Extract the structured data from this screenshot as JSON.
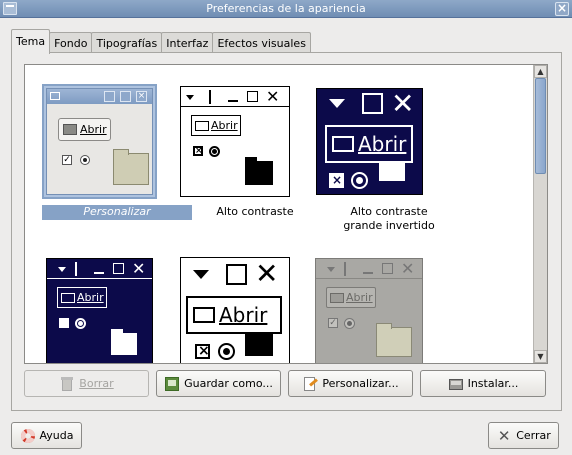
{
  "window": {
    "title": "Preferencias de la apariencia"
  },
  "tabs": [
    {
      "label": "Tema",
      "active": true
    },
    {
      "label": "Fondo"
    },
    {
      "label": "Tipografías"
    },
    {
      "label": "Interfaz"
    },
    {
      "label": "Efectos visuales"
    }
  ],
  "themes": {
    "preview_button_label": "Abrir",
    "items": [
      {
        "name": "Personalizar",
        "selected": true
      },
      {
        "name": "Alto contraste"
      },
      {
        "name": "Alto contraste\ngrande invertido"
      },
      {
        "name": ""
      },
      {
        "name": ""
      },
      {
        "name": ""
      }
    ]
  },
  "actions": {
    "delete": "Borrar",
    "save_as": "Guardar como...",
    "customize": "Personalizar...",
    "install": "Instalar..."
  },
  "footer": {
    "help": "Ayuda",
    "close": "Cerrar"
  },
  "colors": {
    "titlebar": "#7f9abd",
    "selection": "#86a2c6",
    "inverted_bg": "#0c0a4a"
  }
}
